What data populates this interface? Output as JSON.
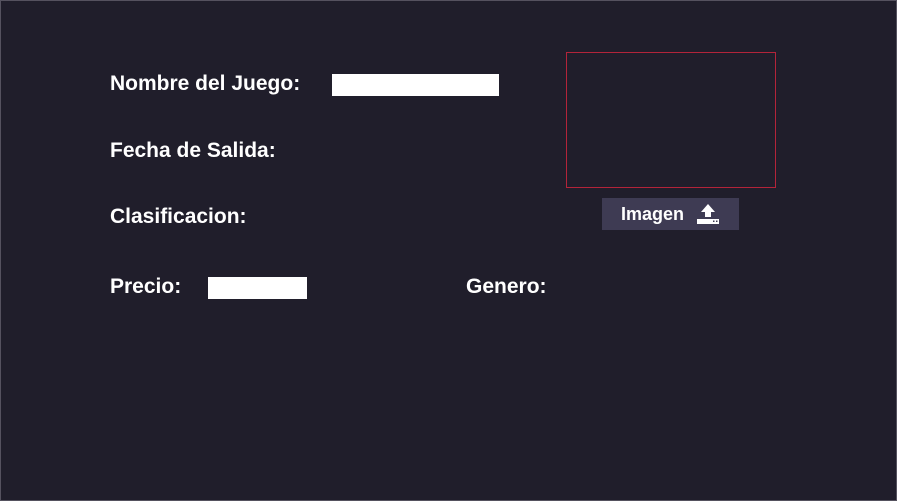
{
  "form": {
    "name_label": "Nombre del Juego:",
    "name_value": "",
    "release_date_label": "Fecha de Salida:",
    "rating_label": "Clasificacion:",
    "price_label": "Precio:",
    "price_value": "",
    "genre_label": "Genero:"
  },
  "image_upload": {
    "button_label": "Imagen",
    "icon": "upload-icon"
  },
  "colors": {
    "background": "#201e2b",
    "image_box_border": "#b3243a",
    "button_background": "#3e3b53",
    "text": "#ffffff"
  }
}
